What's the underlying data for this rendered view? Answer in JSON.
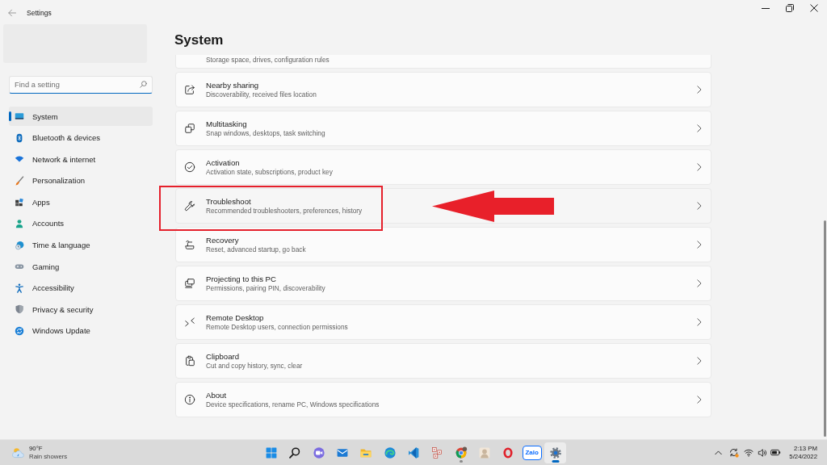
{
  "window": {
    "title": "Settings"
  },
  "sidebar": {
    "search": {
      "placeholder": "Find a setting"
    },
    "items": [
      {
        "label": "System",
        "selected": true
      },
      {
        "label": "Bluetooth & devices",
        "selected": false
      },
      {
        "label": "Network & internet",
        "selected": false
      },
      {
        "label": "Personalization",
        "selected": false
      },
      {
        "label": "Apps",
        "selected": false
      },
      {
        "label": "Accounts",
        "selected": false
      },
      {
        "label": "Time & language",
        "selected": false
      },
      {
        "label": "Gaming",
        "selected": false
      },
      {
        "label": "Accessibility",
        "selected": false
      },
      {
        "label": "Privacy & security",
        "selected": false
      },
      {
        "label": "Windows Update",
        "selected": false
      }
    ]
  },
  "page": {
    "title": "System",
    "items": [
      {
        "kind": "clipped",
        "subtitle": "Storage space, drives, configuration rules",
        "hovered": false,
        "highlighted": false
      },
      {
        "kind": "full",
        "title": "Nearby sharing",
        "subtitle": "Discoverability, received files location",
        "hovered": false,
        "highlighted": false
      },
      {
        "kind": "full",
        "title": "Multitasking",
        "subtitle": "Snap windows, desktops, task switching",
        "hovered": false,
        "highlighted": false
      },
      {
        "kind": "full",
        "title": "Activation",
        "subtitle": "Activation state, subscriptions, product key",
        "hovered": false,
        "highlighted": false
      },
      {
        "kind": "full",
        "title": "Troubleshoot",
        "subtitle": "Recommended troubleshooters, preferences, history",
        "hovered": true,
        "highlighted": true
      },
      {
        "kind": "full",
        "title": "Recovery",
        "subtitle": "Reset, advanced startup, go back",
        "hovered": false,
        "highlighted": false
      },
      {
        "kind": "full",
        "title": "Projecting to this PC",
        "subtitle": "Permissions, pairing PIN, discoverability",
        "hovered": false,
        "highlighted": false
      },
      {
        "kind": "full",
        "title": "Remote Desktop",
        "subtitle": "Remote Desktop users, connection permissions",
        "hovered": false,
        "highlighted": false
      },
      {
        "kind": "full",
        "title": "Clipboard",
        "subtitle": "Cut and copy history, sync, clear",
        "hovered": false,
        "highlighted": false
      },
      {
        "kind": "full",
        "title": "About",
        "subtitle": "Device specifications, rename PC, Windows specifications",
        "hovered": false,
        "highlighted": false
      }
    ]
  },
  "taskbar": {
    "weather": {
      "temperature": "90°F",
      "condition": "Rain showers"
    },
    "apps": [
      {
        "running": false,
        "active": false
      },
      {
        "running": false,
        "active": false
      },
      {
        "running": false,
        "active": false
      },
      {
        "running": false,
        "active": false
      },
      {
        "running": false,
        "active": false
      },
      {
        "running": false,
        "active": false
      },
      {
        "running": false,
        "active": false
      },
      {
        "running": false,
        "active": false
      },
      {
        "running": true,
        "active": false
      },
      {
        "running": false,
        "active": false
      },
      {
        "running": false,
        "active": false
      },
      {
        "text": "Zalo",
        "running": false,
        "active": false
      },
      {
        "running": true,
        "active": true
      }
    ],
    "clock": {
      "time": "2:13 PM",
      "date": "5/24/2022"
    }
  }
}
